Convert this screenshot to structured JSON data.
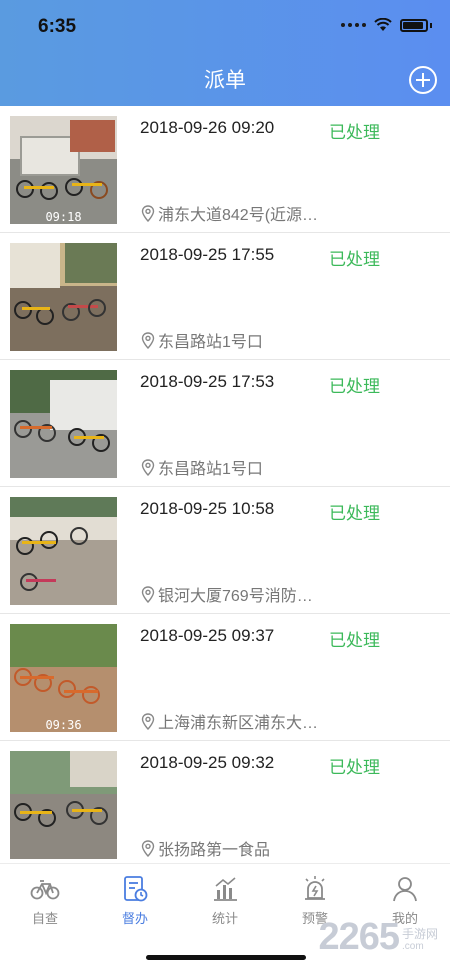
{
  "status_bar": {
    "time": "6:35"
  },
  "header": {
    "title": "派单"
  },
  "orders": [
    {
      "datetime": "2018-09-26 09:20",
      "status": "已处理",
      "location": "浦东大道842号(近源…",
      "photo_stamp": "09:18"
    },
    {
      "datetime": "2018-09-25 17:55",
      "status": "已处理",
      "location": "东昌路站1号口",
      "photo_stamp": ""
    },
    {
      "datetime": "2018-09-25 17:53",
      "status": "已处理",
      "location": "东昌路站1号口",
      "photo_stamp": ""
    },
    {
      "datetime": "2018-09-25 10:58",
      "status": "已处理",
      "location": "银河大厦769号消防…",
      "photo_stamp": ""
    },
    {
      "datetime": "2018-09-25 09:37",
      "status": "已处理",
      "location": "上海浦东新区浦东大…",
      "photo_stamp": "09:36"
    },
    {
      "datetime": "2018-09-25 09:32",
      "status": "已处理",
      "location": "张扬路第一食品",
      "photo_stamp": ""
    }
  ],
  "tabbar": {
    "items": [
      {
        "label": "自查",
        "icon": "bicycle-icon"
      },
      {
        "label": "督办",
        "icon": "supervise-doc-icon"
      },
      {
        "label": "统计",
        "icon": "bar-chart-icon"
      },
      {
        "label": "预警",
        "icon": "alarm-icon"
      },
      {
        "label": "我的",
        "icon": "person-icon"
      }
    ],
    "active_index": 1
  },
  "watermark": {
    "number": "2265",
    "cn": "手游网",
    "com": ".com"
  },
  "colors": {
    "header": "#5b8ef0",
    "status_done": "#3cb95a",
    "tab_active": "#4a7de0",
    "tab_inactive": "#8a8a8a"
  }
}
